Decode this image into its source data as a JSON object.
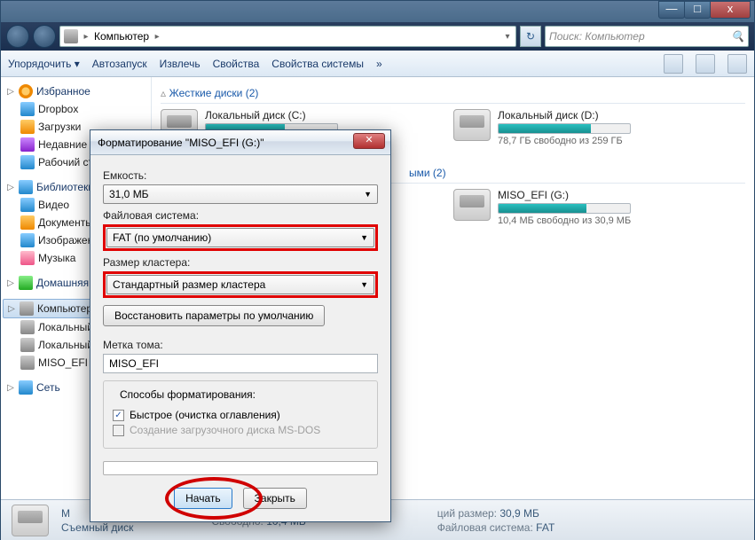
{
  "titlebar": {
    "minimize": "—",
    "maximize": "□",
    "close": "x"
  },
  "nav": {
    "location": "Компьютер",
    "chev": "▸",
    "refresh": "↻",
    "search_placeholder": "Поиск: Компьютер",
    "search_icon": "🔍"
  },
  "toolbar": {
    "organize": "Упорядочить ▾",
    "autoplay": "Автозапуск",
    "eject": "Извлечь",
    "properties": "Свойства",
    "system_props": "Свойства системы",
    "more": "»"
  },
  "sidebar": {
    "favorites": {
      "label": "Избранное",
      "items": [
        "Dropbox",
        "Загрузки",
        "Недавние места",
        "Рабочий стол"
      ]
    },
    "libraries": {
      "label": "Библиотеки",
      "items": [
        "Видео",
        "Документы",
        "Изображения",
        "Музыка"
      ]
    },
    "homegroup": {
      "label": "Домашняя группа"
    },
    "computer": {
      "label": "Компьютер",
      "items": [
        "Локальный диск",
        "Локальный диск",
        "MISO_EFI"
      ]
    },
    "network": {
      "label": "Сеть"
    }
  },
  "content": {
    "section_hdd": "Жесткие диски (2)",
    "section_removable": "ыми (2)",
    "drives": {
      "c": {
        "name": "Локальный диск (C:)",
        "fill": 60
      },
      "d": {
        "name": "Локальный диск (D:)",
        "free": "78,7 ГБ свободно из 259 ГБ",
        "fill": 70
      },
      "g": {
        "name": "MISO_EFI (G:)",
        "free": "10,4 МБ свободно из 30,9 МБ",
        "fill": 67
      }
    }
  },
  "statusbar": {
    "name_prefix": "M",
    "type": "Съемный диск",
    "free_lbl": "Свободно:",
    "free_val": "10,4 МБ",
    "size_lbl": "ций размер:",
    "size_val": "30,9 МБ",
    "fs_lbl": "Файловая система:",
    "fs_val": "FAT"
  },
  "dialog": {
    "title": "Форматирование \"MISO_EFI (G:)\"",
    "capacity_lbl": "Емкость:",
    "capacity_val": "31,0 МБ",
    "fs_lbl": "Файловая система:",
    "fs_val": "FAT (по умолчанию)",
    "cluster_lbl": "Размер кластера:",
    "cluster_val": "Стандартный размер кластера",
    "restore_btn": "Восстановить параметры по умолчанию",
    "label_lbl": "Метка тома:",
    "label_val": "MISO_EFI",
    "options_lbl": "Способы форматирования:",
    "quick_chk": "Быстрое (очистка оглавления)",
    "msdos_chk": "Создание загрузочного диска MS-DOS",
    "start_btn": "Начать",
    "close_btn": "Закрыть"
  }
}
